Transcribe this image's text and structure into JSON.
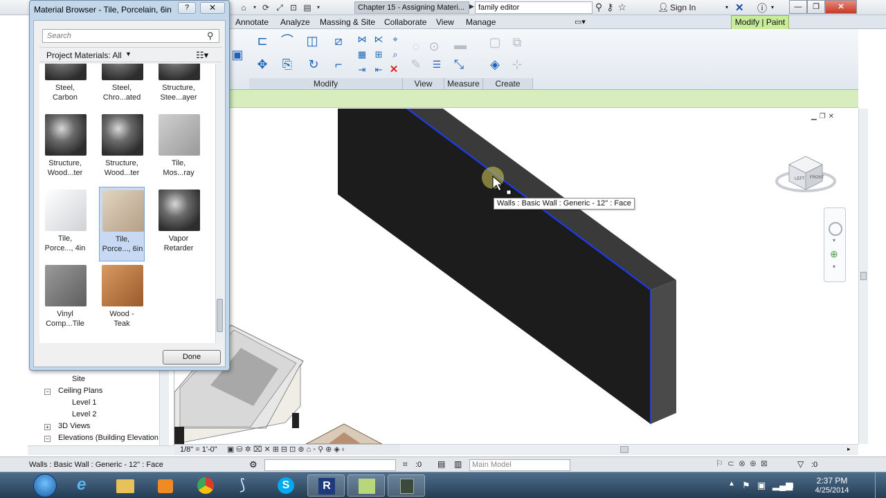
{
  "title_bar": {
    "document": "Chapter 15 - Assigning Materi...",
    "help_search_value": "family editor",
    "sign_in": "Sign In"
  },
  "ribbon": {
    "tabs": [
      "Annotate",
      "Analyze",
      "Massing & Site",
      "Collaborate",
      "View",
      "Manage"
    ],
    "active_tab": "Modify | Paint",
    "panels": [
      "Modify",
      "View",
      "Measure",
      "Create"
    ]
  },
  "viewport": {
    "tooltip": "Walls : Basic Wall : Generic - 12\" : Face",
    "viewcube_faces": [
      "LEFT",
      "FRONT"
    ]
  },
  "view_bar": {
    "scale": "1/8\" = 1'-0\""
  },
  "project_browser": {
    "items": [
      "Site",
      "Ceiling Plans",
      "Level 1",
      "Level 2",
      "3D Views",
      "Elevations (Building Elevation"
    ]
  },
  "status_bar": {
    "text": "Walls : Basic Wall : Generic - 12\" : Face",
    "zero_a": ":0",
    "model": "Main Model",
    "zero_b": ":0"
  },
  "taskbar": {
    "time": "2:37 PM",
    "date": "4/25/2014"
  },
  "material_browser": {
    "title": "Material Browser - Tile, Porcelain, 6in",
    "help": "?",
    "search_placeholder": "Search",
    "breadcrumb": "Project Materials: All",
    "done": "Done",
    "tiles": [
      {
        "label": "Steel,\nCarbon",
        "kind": "sphere"
      },
      {
        "label": "Steel,\nChro...ated",
        "kind": "sphere"
      },
      {
        "label": "Structure,\nStee...ayer",
        "kind": "sphere"
      },
      {
        "label": "Structure,\nWood...ter",
        "kind": "sphere"
      },
      {
        "label": "Structure,\nWood...ter",
        "kind": "sphere"
      },
      {
        "label": "Tile,\nMos...ray",
        "kind": "cube-gray"
      },
      {
        "label": "Tile,\nPorce..., 4in",
        "kind": "cube-white"
      },
      {
        "label": "Tile,\nPorce..., 6in",
        "kind": "cube-beige",
        "selected": true
      },
      {
        "label": "Vapor\nRetarder",
        "kind": "sphere"
      },
      {
        "label": "Vinyl\nComp...Tile",
        "kind": "cube-darkgray"
      },
      {
        "label": "Wood -\nTeak",
        "kind": "cube-wood"
      }
    ]
  }
}
